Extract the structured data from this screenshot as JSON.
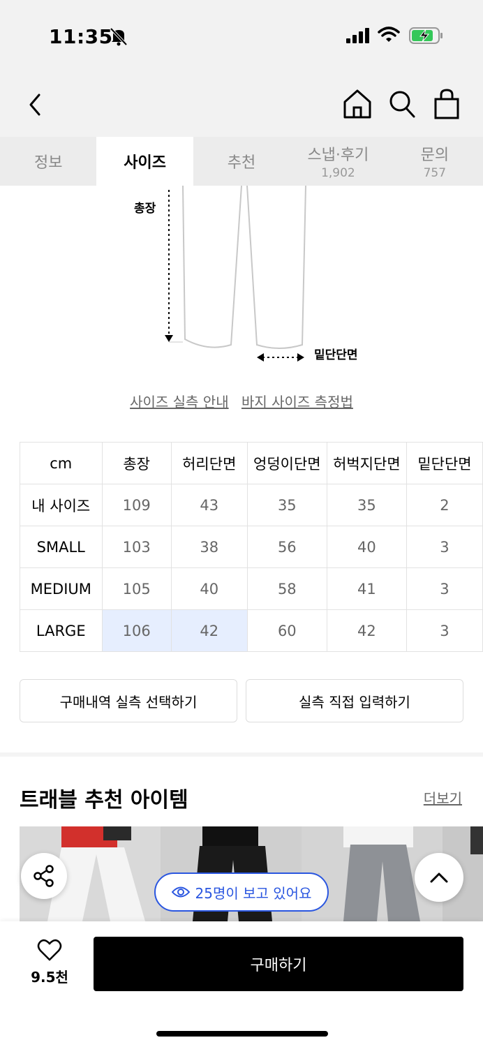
{
  "status_bar": {
    "time": "11:35"
  },
  "tabs": [
    {
      "label": "정보",
      "count": ""
    },
    {
      "label": "사이즈",
      "count": ""
    },
    {
      "label": "추천",
      "count": ""
    },
    {
      "label": "스냅·후기",
      "count": "1,902"
    },
    {
      "label": "문의",
      "count": "757"
    }
  ],
  "active_tab": "사이즈",
  "diagram": {
    "label_total_length": "총장",
    "label_hem": "밑단단면"
  },
  "links": {
    "guide": "사이즈 실측 안내",
    "measure": "바지 사이즈 측정법"
  },
  "size_table": {
    "headers": [
      "cm",
      "총장",
      "허리단면",
      "엉덩이단면",
      "허벅지단면",
      "밑단단면"
    ],
    "rows": [
      {
        "name": "내 사이즈",
        "values": [
          "109",
          "43",
          "35",
          "35",
          "2"
        ]
      },
      {
        "name": "SMALL",
        "values": [
          "103",
          "38",
          "56",
          "40",
          "3"
        ]
      },
      {
        "name": "MEDIUM",
        "values": [
          "105",
          "40",
          "58",
          "41",
          "3"
        ]
      },
      {
        "name": "LARGE",
        "values": [
          "106",
          "42",
          "60",
          "42",
          "3"
        ]
      }
    ]
  },
  "buttons": {
    "select_purchase": "구매내역 실측 선택하기",
    "input_direct": "실측 직접 입력하기"
  },
  "recommend": {
    "title": "트래블 추천 아이템",
    "more": "더보기"
  },
  "viewers": "25명이 보고 있어요",
  "bottom": {
    "likes": "9.5천",
    "buy": "구매하기"
  },
  "colors": {
    "accent_blue": "#2a56e0",
    "highlight": "#e6eefe"
  }
}
